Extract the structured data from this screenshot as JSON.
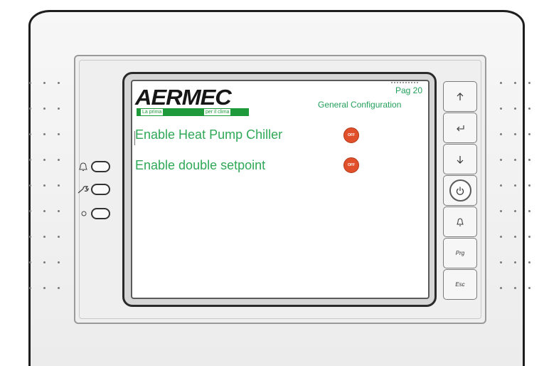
{
  "screen": {
    "brand": "AERMEC",
    "brand_tagline_1": "La prima",
    "brand_tagline_2": "per il clima",
    "page_number": "Pag 20",
    "page_title": "General Configuration",
    "settings": [
      {
        "label": "Enable Heat Pump Chiller",
        "value": "OFF"
      },
      {
        "label": "Enable double setpoint",
        "value": "OFF"
      }
    ]
  },
  "keypad": {
    "up_icon": "arrow-up-icon",
    "enter_icon": "enter-return-icon",
    "down_icon": "arrow-down-icon",
    "power_icon": "power-icon",
    "alarm_icon": "bell-icon",
    "prg_label": "Prg",
    "esc_label": "Esc"
  },
  "leds": [
    {
      "name": "alarm",
      "icon": "bell-icon"
    },
    {
      "name": "service",
      "icon": "wrench-icon"
    },
    {
      "name": "power",
      "icon": "circle-icon"
    }
  ],
  "colors": {
    "text_green": "#2fa857",
    "logo_bar": "#1f9a3a",
    "toggle_off": "#e0502a"
  }
}
